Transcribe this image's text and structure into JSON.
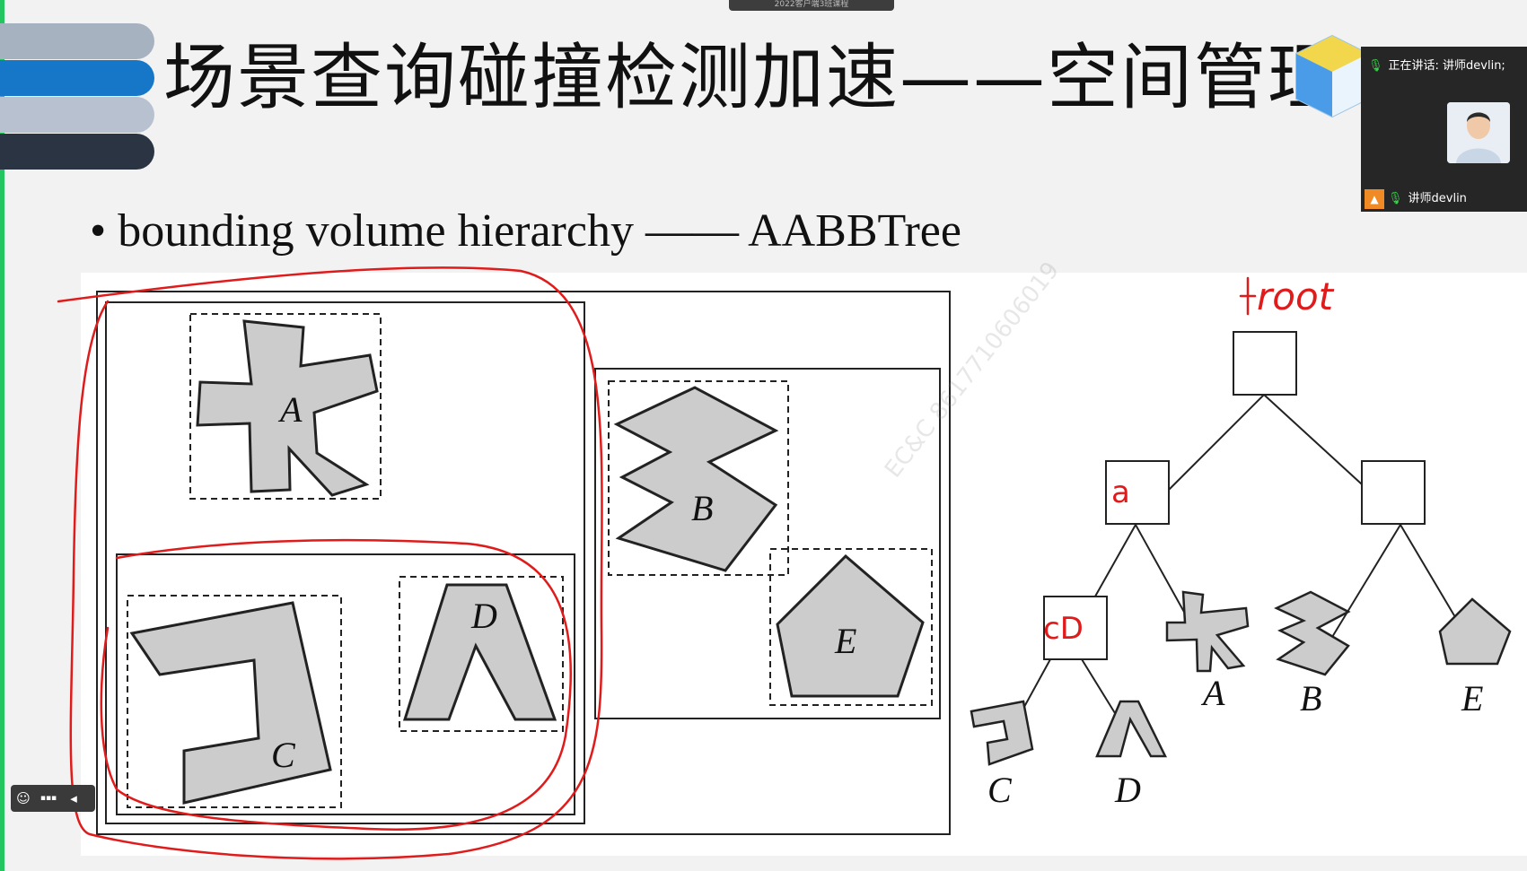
{
  "window_tab": "2022客户端3班课程",
  "title": "场景查询碰撞检测加速——空间管理",
  "bullet": "• bounding volume hierarchy —— AABBTree",
  "video": {
    "speaking": "正在讲话: 讲师devlin;",
    "lecturer": "讲师devlin"
  },
  "watermark": "EC&C 8617710606019",
  "diagram": {
    "shape_labels": {
      "A": "A",
      "B": "B",
      "C": "C",
      "D": "D",
      "E": "E"
    },
    "tree_labels": {
      "A": "A",
      "B": "B",
      "C": "C",
      "D": "D",
      "E": "E"
    }
  },
  "annotations": {
    "root": "root",
    "node_left": "a",
    "node_cd": "cD"
  },
  "toolbar": {
    "emoji_icon": "☺",
    "chat_icon": "▪▪▪",
    "collapse_icon": "◂"
  },
  "colors": {
    "shape_fill": "#cccccc",
    "annotation": "#e01b1b",
    "accent_blue": "#1677c9",
    "speaker_green": "#3ecf4e"
  }
}
